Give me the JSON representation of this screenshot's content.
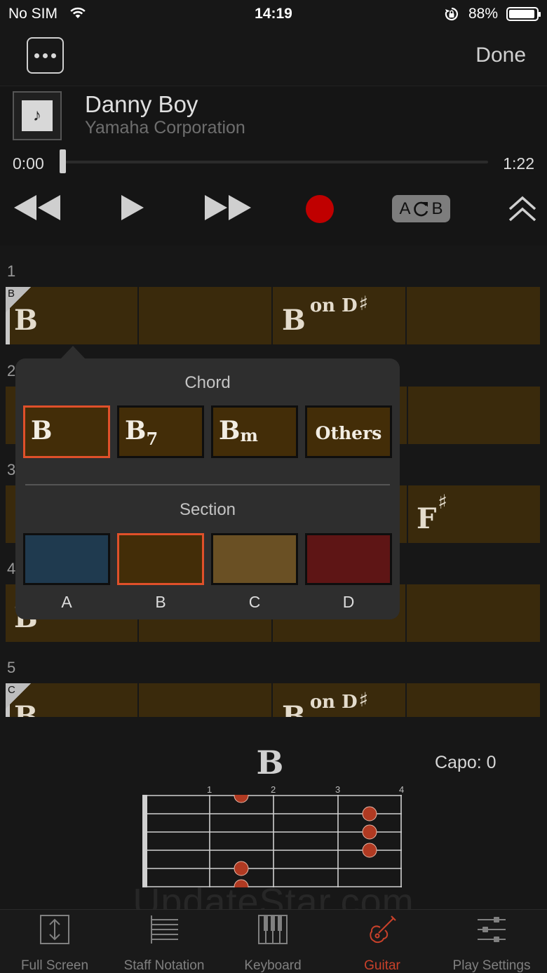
{
  "status_bar": {
    "carrier": "No SIM",
    "time": "14:19",
    "battery": "88%"
  },
  "top_bar": {
    "done_label": "Done"
  },
  "song": {
    "title": "Danny Boy",
    "artist": "Yamaha Corporation",
    "art_icon": "♪"
  },
  "playback": {
    "time_current": "0:00",
    "time_total": "1:22",
    "progress": 0
  },
  "transport": {
    "ab_label_a": "A",
    "ab_label_b": "B"
  },
  "bars": [
    {
      "number": "1",
      "section": "B",
      "chord_1": "B",
      "chord_3": "B",
      "chord_3_on": "on D",
      "chord_3_sharp": "♯"
    },
    {
      "number": "2"
    },
    {
      "number": "3",
      "chord_4": "F",
      "chord_4_sharp": "♯"
    },
    {
      "number": "4",
      "chord_1": "B"
    },
    {
      "number": "5",
      "section": "C",
      "chord_1": "B",
      "chord_3": "B",
      "chord_3_on": "on D",
      "chord_3_sharp": "♯"
    }
  ],
  "popover": {
    "chord_label": "Chord",
    "chord_options": [
      {
        "root": "B",
        "suffix": "",
        "selected": true
      },
      {
        "root": "B",
        "suffix": "7",
        "selected": false
      },
      {
        "root": "B",
        "suffix": "m",
        "selected": false
      },
      {
        "root": "Others",
        "suffix": "",
        "selected": false
      }
    ],
    "section_label": "Section",
    "section_options": [
      {
        "label": "A",
        "color": "#1f3a4f",
        "selected": false
      },
      {
        "label": "B",
        "color": "#432d08",
        "selected": true
      },
      {
        "label": "C",
        "color": "#6a5024",
        "selected": false
      },
      {
        "label": "D",
        "color": "#5e1515",
        "selected": false
      }
    ]
  },
  "diagram": {
    "chord": "B",
    "capo": "Capo: 0",
    "fret_numbers": [
      "1",
      "2",
      "3",
      "4"
    ]
  },
  "tabs": [
    {
      "label": "Full Screen",
      "icon": "full-screen-icon",
      "active": false
    },
    {
      "label": "Staff Notation",
      "icon": "staff-notation-icon",
      "active": false
    },
    {
      "label": "Keyboard",
      "icon": "keyboard-icon",
      "active": false
    },
    {
      "label": "Guitar",
      "icon": "guitar-icon",
      "active": true
    },
    {
      "label": "Play Settings",
      "icon": "play-settings-icon",
      "active": false
    }
  ],
  "watermark": "UpdateStar.com",
  "colors": {
    "accent": "#c9412a",
    "record": "#c00000",
    "chord_cell": "#3a2a0c",
    "dot": "#b03a22"
  }
}
